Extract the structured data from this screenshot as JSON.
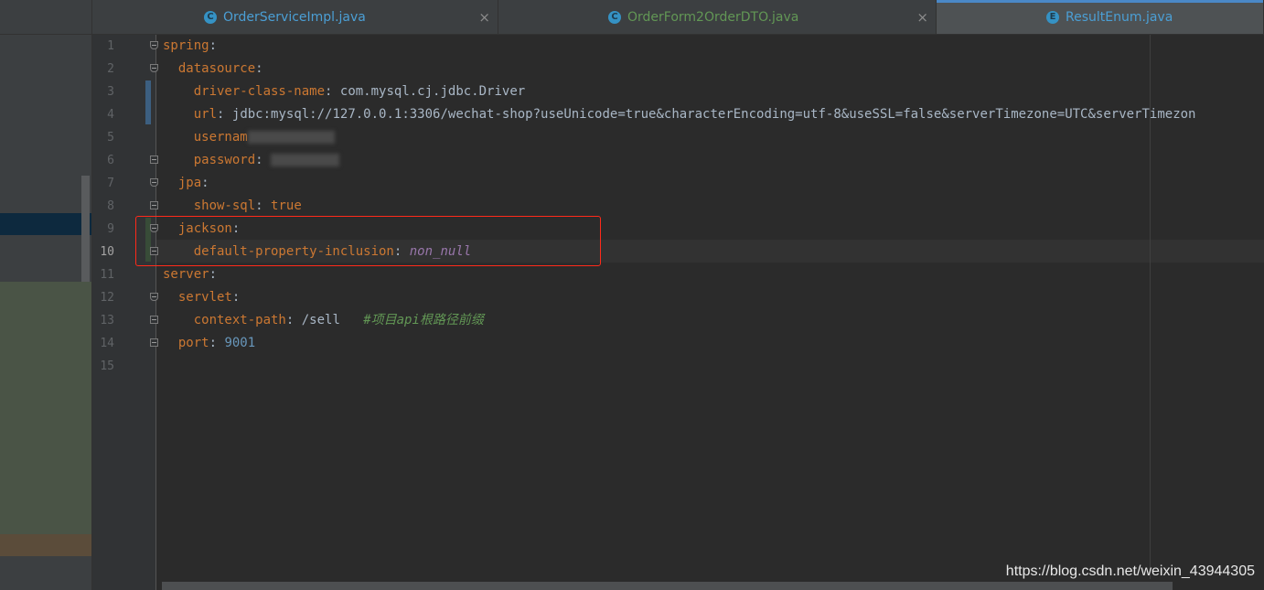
{
  "tabs": [
    {
      "label": "OrderServiceImpl.java",
      "icon": "C",
      "close": "×"
    },
    {
      "label": "OrderForm2OrderDTO.java",
      "icon": "C",
      "close": "×"
    },
    {
      "label": "ResultEnum.java",
      "icon": "E"
    }
  ],
  "lines": [
    "1",
    "2",
    "3",
    "4",
    "5",
    "6",
    "7",
    "8",
    "9",
    "10",
    "11",
    "12",
    "13",
    "14",
    "15"
  ],
  "code": {
    "l1_key": "spring",
    "l2_key": "datasource",
    "l3_key": "driver-class-name",
    "l3_val": "com.mysql.cj.jdbc.Driver",
    "l4_key": "url",
    "l4_val": "jdbc:mysql://127.0.0.1:3306/wechat-shop?useUnicode=true&characterEncoding=utf-8&useSSL=false&serverTimezone=UTC&serverTimezon",
    "l5_key": "usernam",
    "l6_key": "password",
    "l7_key": "jpa",
    "l8_key": "show-sql",
    "l8_val": "true",
    "l9_key": "jackson",
    "l10_key": "default-property-inclusion",
    "l10_val": "non_null",
    "l11_key": "server",
    "l12_key": "servlet",
    "l13_key": "context-path",
    "l13_val": "/sell",
    "l13_comment": "#项目api根路径前缀",
    "l14_key": "port",
    "l14_val": "9001",
    "colon": ":"
  },
  "watermark": "https://blog.csdn.net/weixin_43944305",
  "colors": {
    "accent": "#4a88c7",
    "highlight_box": "#ff2a1a",
    "key": "#cc7832",
    "number": "#6897bb",
    "comment": "#629755"
  }
}
